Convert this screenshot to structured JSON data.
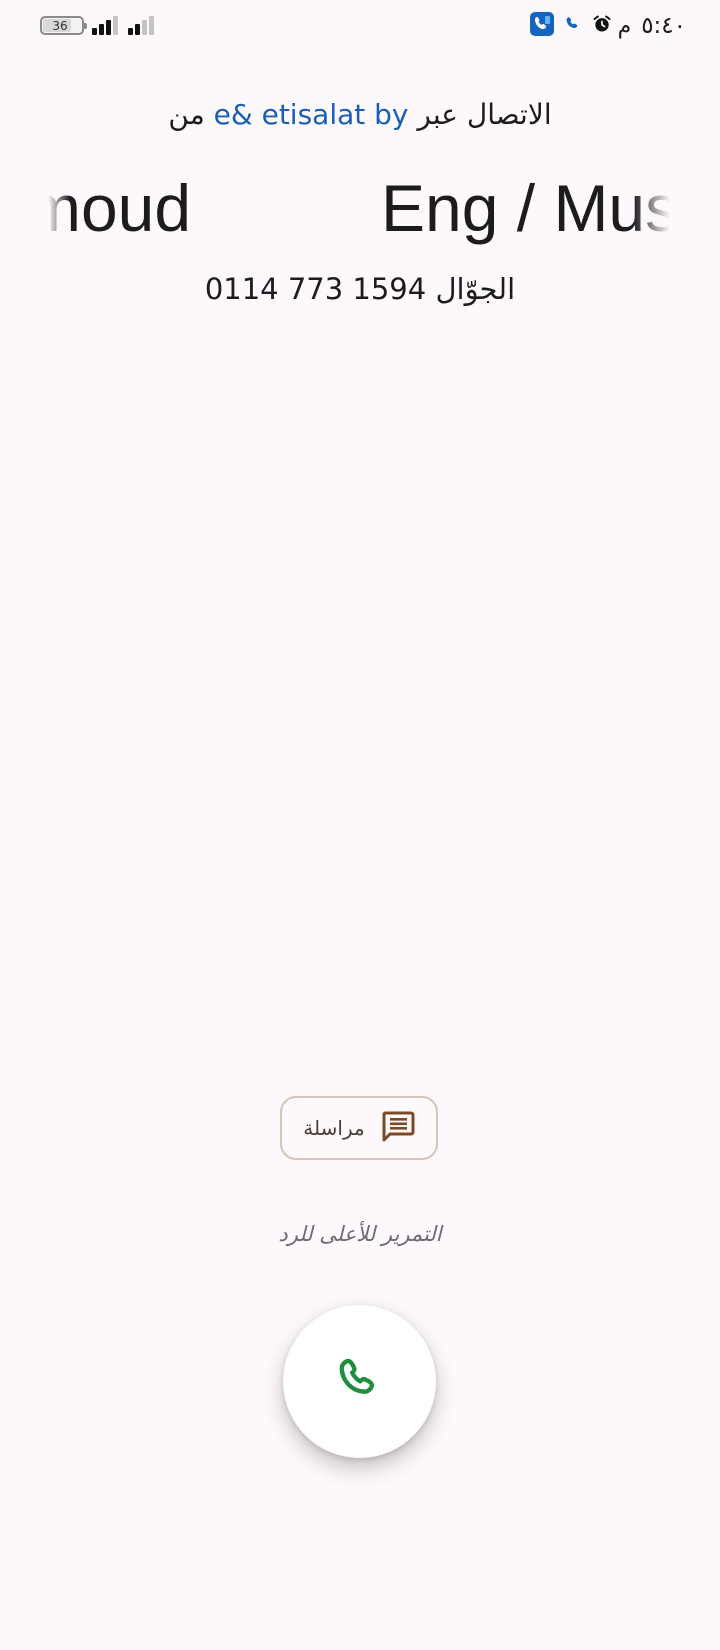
{
  "status_bar": {
    "battery_level": "36",
    "signal_icons": [
      "signal-strength-icon",
      "signal-strength-icon"
    ],
    "right_icons": [
      "dialer-app-icon",
      "call-indicator-icon",
      "alarm-icon"
    ],
    "time": "٥:٤٠",
    "ampm": "م"
  },
  "call": {
    "via_prefix": "الاتصال عبر",
    "carrier": "e& etisalat by",
    "via_suffix": "من",
    "caller_name_part_a": "moud",
    "caller_name_part_b": "Eng / Must",
    "number_type": "الجوّال",
    "number": "0114 773 1594"
  },
  "actions": {
    "message_label": "مراسلة",
    "swipe_hint": "التمرير للأعلى للرد"
  },
  "colors": {
    "background": "#fdf8fb",
    "carrier": "#1a5fb4",
    "answer_icon": "#1e8e3e",
    "message_icon": "#7a4a26"
  }
}
